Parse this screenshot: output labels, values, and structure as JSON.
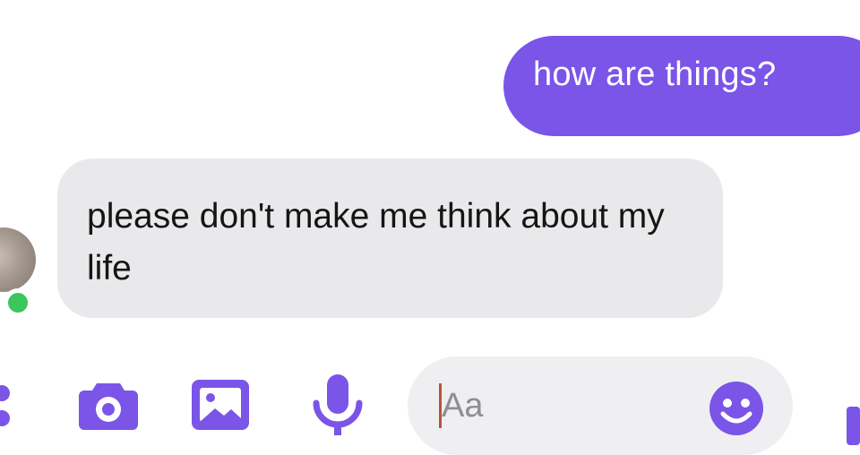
{
  "conversation": {
    "sent_message": "how are things?",
    "received_message": "please don't make me think about my life"
  },
  "composer": {
    "placeholder": "Aa"
  },
  "icons": {
    "menu": "vertical-dots-icon",
    "camera": "camera-icon",
    "gallery": "image-icon",
    "microphone": "microphone-icon",
    "emoji": "smiley-icon",
    "send": "send-icon"
  },
  "colors": {
    "accent": "#7a55e8",
    "received_bubble": "#e9e9eb",
    "online": "#3cc55c"
  }
}
